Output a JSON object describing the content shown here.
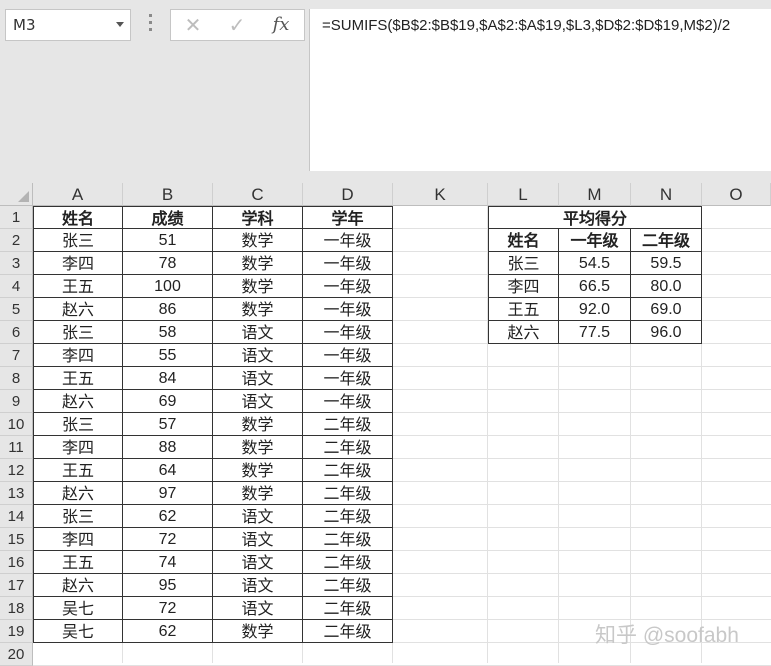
{
  "name_box": "M3",
  "formula_bar": {
    "cancel_icon": "✕",
    "enter_icon": "✓",
    "fx_label": "fx",
    "formula": "=SUMIFS($B$2:$B$19,$A$2:$A$19,$L3,$D$2:$D$19,M$2)/2"
  },
  "columns": [
    "A",
    "B",
    "C",
    "D",
    "K",
    "L",
    "M",
    "N",
    "O"
  ],
  "rows": [
    "1",
    "2",
    "3",
    "4",
    "5",
    "6",
    "7",
    "8",
    "9",
    "10",
    "11",
    "12",
    "13",
    "14",
    "15",
    "16",
    "17",
    "18",
    "19",
    "20"
  ],
  "left_table": {
    "headers": [
      "姓名",
      "成绩",
      "学科",
      "学年"
    ],
    "rows": [
      [
        "张三",
        "51",
        "数学",
        "一年级"
      ],
      [
        "李四",
        "78",
        "数学",
        "一年级"
      ],
      [
        "王五",
        "100",
        "数学",
        "一年级"
      ],
      [
        "赵六",
        "86",
        "数学",
        "一年级"
      ],
      [
        "张三",
        "58",
        "语文",
        "一年级"
      ],
      [
        "李四",
        "55",
        "语文",
        "一年级"
      ],
      [
        "王五",
        "84",
        "语文",
        "一年级"
      ],
      [
        "赵六",
        "69",
        "语文",
        "一年级"
      ],
      [
        "张三",
        "57",
        "数学",
        "二年级"
      ],
      [
        "李四",
        "88",
        "数学",
        "二年级"
      ],
      [
        "王五",
        "64",
        "数学",
        "二年级"
      ],
      [
        "赵六",
        "97",
        "数学",
        "二年级"
      ],
      [
        "张三",
        "62",
        "语文",
        "二年级"
      ],
      [
        "李四",
        "72",
        "语文",
        "二年级"
      ],
      [
        "王五",
        "74",
        "语文",
        "二年级"
      ],
      [
        "赵六",
        "95",
        "语文",
        "二年级"
      ],
      [
        "吴七",
        "72",
        "语文",
        "二年级"
      ],
      [
        "吴七",
        "62",
        "数学",
        "二年级"
      ]
    ]
  },
  "right_table": {
    "title": "平均得分",
    "headers": [
      "姓名",
      "一年级",
      "二年级"
    ],
    "rows": [
      [
        "张三",
        "54.5",
        "59.5"
      ],
      [
        "李四",
        "66.5",
        "80.0"
      ],
      [
        "王五",
        "92.0",
        "69.0"
      ],
      [
        "赵六",
        "77.5",
        "96.0"
      ]
    ]
  },
  "watermark": "知乎 @soofabh"
}
